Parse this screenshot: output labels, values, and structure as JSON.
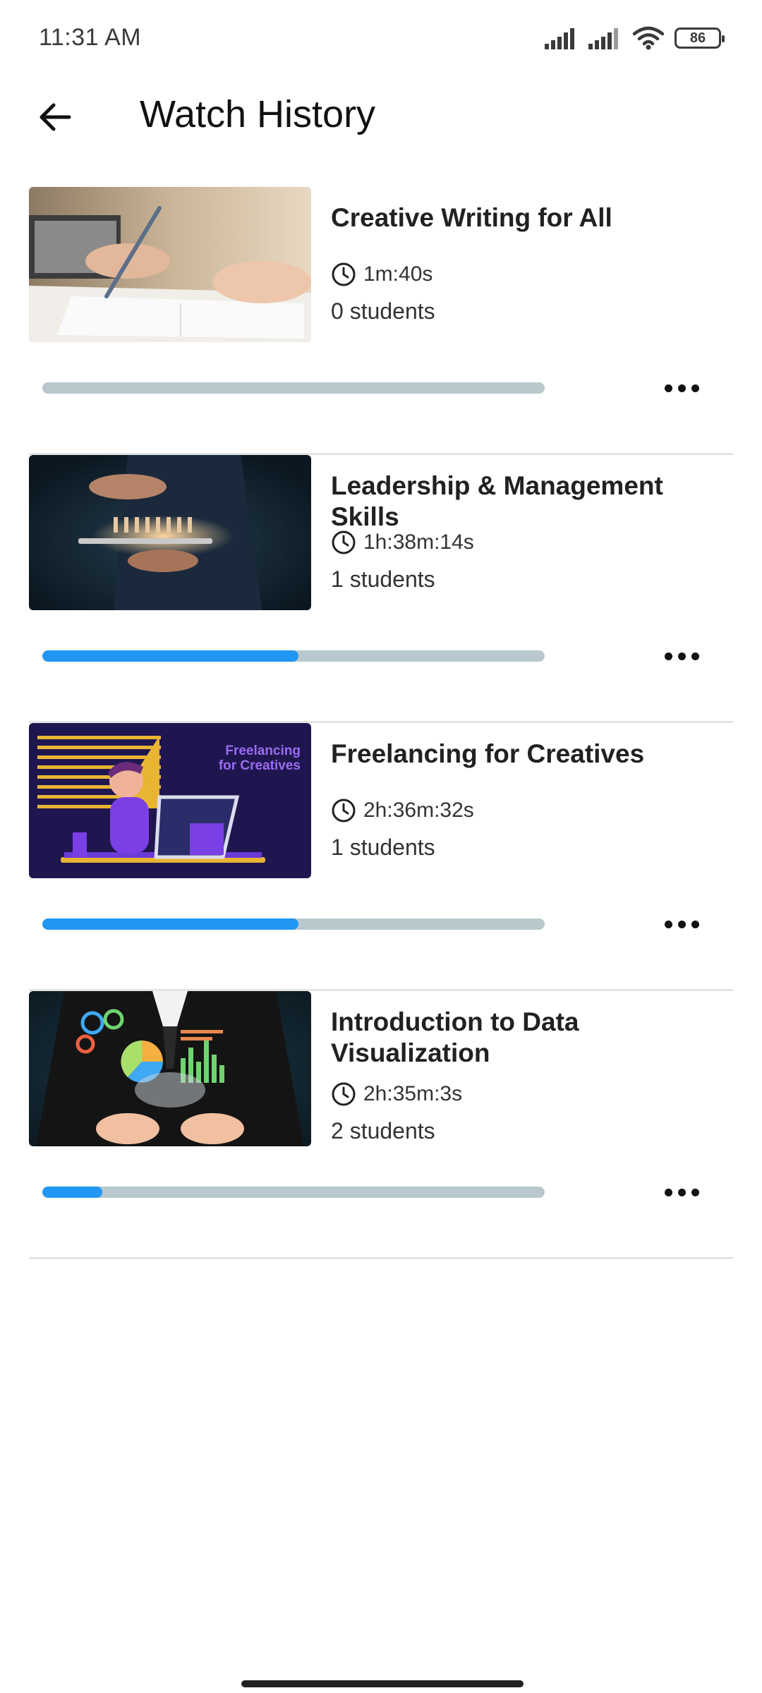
{
  "status_bar": {
    "time": "11:31 AM",
    "battery": "86"
  },
  "header": {
    "title": "Watch History",
    "back_icon": "arrow-left-icon"
  },
  "courses": [
    {
      "title": "Creative Writing for All",
      "duration": "1m:40s",
      "students": "0 students",
      "progress": 0.0
    },
    {
      "title": "Leadership & Management Skills",
      "duration": "1h:38m:14s",
      "students": "1 students",
      "progress": 0.51
    },
    {
      "title": "Freelancing for Creatives",
      "duration": "2h:36m:32s",
      "students": "1 students",
      "progress": 0.51,
      "thumbnail_text_1": "Freelancing",
      "thumbnail_text_2": "for Creatives"
    },
    {
      "title": "Introduction to Data Visualization",
      "duration": "2h:35m:3s",
      "students": "2 students",
      "progress": 0.12
    }
  ],
  "colors": {
    "accent": "#2196f3",
    "track": "#b9c8cd",
    "divider": "#e4e4e4"
  }
}
